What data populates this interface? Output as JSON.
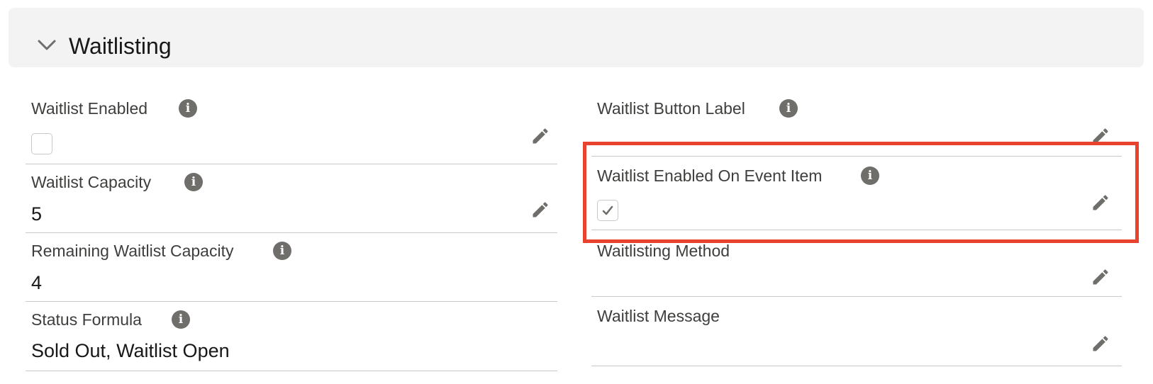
{
  "section": {
    "title": "Waitlisting",
    "chevron_icon": "chevron-down-icon"
  },
  "left_fields": {
    "waitlist_enabled": {
      "label": "Waitlist Enabled",
      "checked": false
    },
    "waitlist_capacity": {
      "label": "Waitlist Capacity",
      "value": "5"
    },
    "remaining_capacity": {
      "label": "Remaining Waitlist Capacity",
      "value": "4"
    },
    "status_formula": {
      "label": "Status Formula",
      "value": "Sold Out, Waitlist Open"
    }
  },
  "right_fields": {
    "button_label": {
      "label": "Waitlist Button Label",
      "value": ""
    },
    "enabled_on_event_item": {
      "label": "Waitlist Enabled On Event Item",
      "checked": true
    },
    "waitlisting_method": {
      "label": "Waitlisting Method",
      "value": ""
    },
    "waitlist_message": {
      "label": "Waitlist Message",
      "value": ""
    }
  },
  "icons": {
    "info": "info-icon",
    "edit": "pencil-icon",
    "check": "checkmark-icon"
  },
  "colors": {
    "highlight": "#e8432e",
    "header_bg": "#f3f3f3",
    "icon": "#706e6b"
  }
}
